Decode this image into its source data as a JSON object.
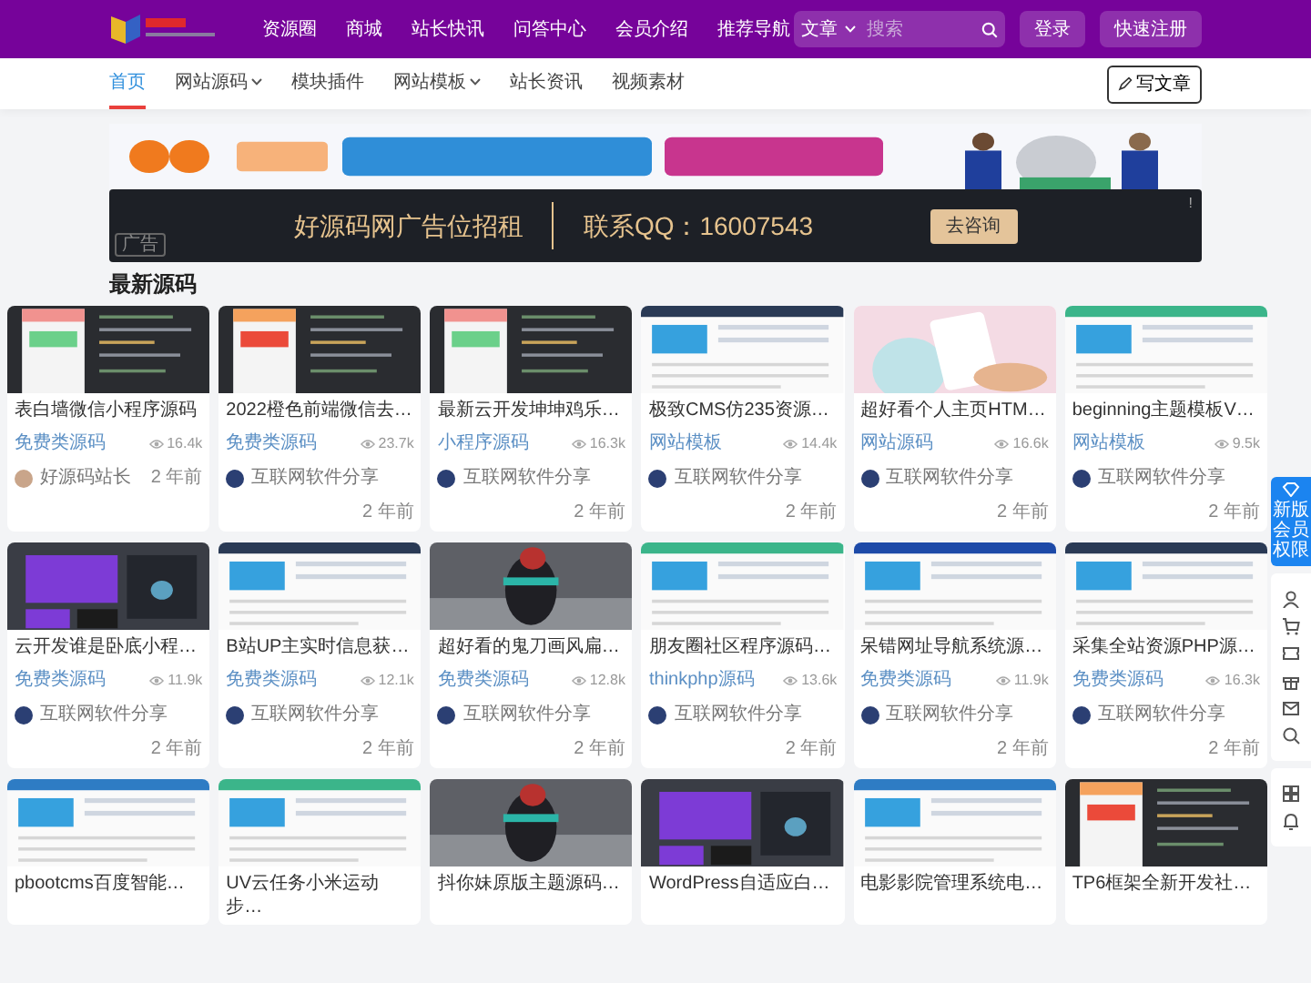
{
  "header": {
    "nav": [
      "资源圈",
      "商城",
      "站长快讯",
      "问答中心",
      "会员介绍",
      "推荐导航"
    ],
    "search": {
      "scope": "文章",
      "placeholder": "搜索"
    },
    "buttons": [
      "登录",
      "快速注册"
    ]
  },
  "subnav": {
    "items": [
      {
        "label": "首页",
        "selected": true,
        "has_menu": false
      },
      {
        "label": "网站源码",
        "selected": false,
        "has_menu": true
      },
      {
        "label": "模块插件",
        "selected": false,
        "has_menu": false
      },
      {
        "label": "网站模板",
        "selected": false,
        "has_menu": true
      },
      {
        "label": "站长资讯",
        "selected": false,
        "has_menu": false
      },
      {
        "label": "视频素材",
        "selected": false,
        "has_menu": false
      }
    ],
    "write_button": "写文章"
  },
  "ad": {
    "text": "好源码网广告位招租",
    "contact": "联系QQ：16007543",
    "button": "去咨询",
    "tag": "广告",
    "mark": "!"
  },
  "section_title": "最新源码",
  "cards": [
    {
      "title": "表白墙微信小程序源码",
      "category": "免费类源码",
      "views": "16.4k",
      "author": "好源码站长",
      "time": "2 年前"
    },
    {
      "title": "2022橙色前端微信去…",
      "category": "免费类源码",
      "views": "23.7k",
      "author": "互联网软件分享",
      "time": "2 年前"
    },
    {
      "title": "最新云开发坤坤鸡乐…",
      "category": "小程序源码",
      "views": "16.3k",
      "author": "互联网软件分享",
      "time": "2 年前"
    },
    {
      "title": "极致CMS仿235资源…",
      "category": "网站模板",
      "views": "14.4k",
      "author": "互联网软件分享",
      "time": "2 年前"
    },
    {
      "title": "超好看个人主页HTM…",
      "category": "网站源码",
      "views": "16.6k",
      "author": "互联网软件分享",
      "time": "2 年前"
    },
    {
      "title": "beginning主题模板V…",
      "category": "网站模板",
      "views": "9.5k",
      "author": "互联网软件分享",
      "time": "2 年前"
    },
    {
      "title": "云开发谁是卧底小程…",
      "category": "免费类源码",
      "views": "11.9k",
      "author": "互联网软件分享",
      "time": "2 年前"
    },
    {
      "title": "B站UP主实时信息获…",
      "category": "免费类源码",
      "views": "12.1k",
      "author": "互联网软件分享",
      "time": "2 年前"
    },
    {
      "title": "超好看的鬼刀画风扁…",
      "category": "免费类源码",
      "views": "12.8k",
      "author": "互联网软件分享",
      "time": "2 年前"
    },
    {
      "title": "朋友圈社区程序源码…",
      "category": "thinkphp源码",
      "views": "13.6k",
      "author": "互联网软件分享",
      "time": "2 年前"
    },
    {
      "title": "呆错网址导航系统源…",
      "category": "免费类源码",
      "views": "11.9k",
      "author": "互联网软件分享",
      "time": "2 年前"
    },
    {
      "title": "采集全站资源PHP源…",
      "category": "免费类源码",
      "views": "16.3k",
      "author": "互联网软件分享",
      "time": "2 年前"
    },
    {
      "title": "pbootcms百度智能…"
    },
    {
      "title": "UV云任务小米运动步…"
    },
    {
      "title": "抖你妹原版主题源码…"
    },
    {
      "title": "WordPress自适应白…"
    },
    {
      "title": "电影影院管理系统电…"
    },
    {
      "title": "TP6框架全新开发社…"
    }
  ],
  "side_panel": {
    "promo": "新版会员权限"
  }
}
